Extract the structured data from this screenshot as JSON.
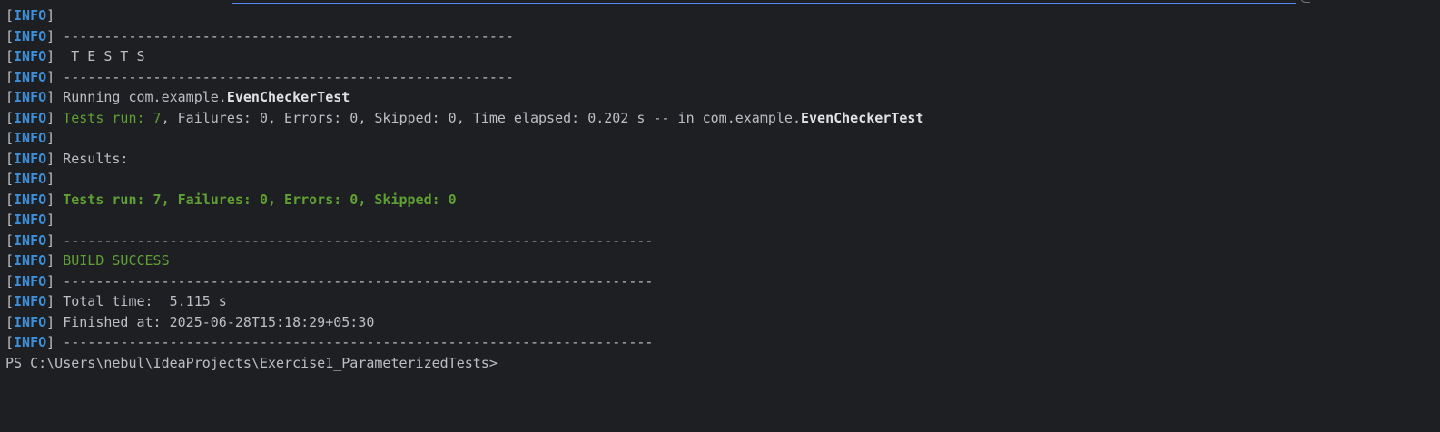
{
  "console": {
    "level": "INFO",
    "sep_short": "-------------------------------------------------------",
    "sep_long": "------------------------------------------------------------------------",
    "tests_title": " T E S T S",
    "running_prefix": "Running com.example.",
    "test_class": "EvenCheckerTest",
    "class_run": {
      "green": "Tests run: 7",
      "rest": ", Failures: 0, Errors: 0, Skipped: 0, Time elapsed: 0.202 s -- in com.example."
    },
    "results_label": "Results:",
    "summary": "Tests run: 7, Failures: 0, Errors: 0, Skipped: 0",
    "build_status": "BUILD SUCCESS",
    "total_time": "Total time:  5.115 s",
    "finished_at": "Finished at: 2025-06-28T15:18:29+05:30"
  },
  "prompt": "PS C:\\Users\\nebul\\IdeaProjects\\Exercise1_ParameterizedTests>",
  "colors": {
    "background": "#1e1f22",
    "info_level": "#3d8fd9",
    "success_green": "#5fa033",
    "text": "#bcbec4",
    "link": "#548af7"
  }
}
